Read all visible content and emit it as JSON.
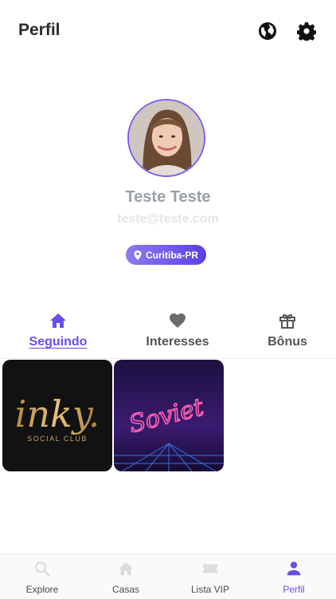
{
  "header": {
    "title": "Perfil",
    "globe_icon": "globe-icon",
    "settings_icon": "gear-icon"
  },
  "profile": {
    "name": "Teste Teste",
    "email": "teste@teste.com",
    "location": "Curitiba-PR"
  },
  "tabs": [
    {
      "label": "Seguindo",
      "icon": "home-icon",
      "active": true
    },
    {
      "label": "Interesses",
      "icon": "heart-icon",
      "active": false
    },
    {
      "label": "Bônus",
      "icon": "gift-icon",
      "active": false
    }
  ],
  "following": [
    {
      "logo_text": "inky.",
      "subtitle": "SOCIAL CLUB"
    },
    {
      "logo_text": "Soviet"
    }
  ],
  "bottom_nav": [
    {
      "label": "Explore",
      "icon": "search-icon",
      "active": false
    },
    {
      "label": "Casas",
      "icon": "home-icon",
      "active": false
    },
    {
      "label": "Lista VIP",
      "icon": "ticket-icon",
      "active": false
    },
    {
      "label": "Perfil",
      "icon": "person-icon",
      "active": true
    }
  ],
  "colors": {
    "accent": "#6a4ee8",
    "inactive_icon": "#d9d9d9"
  }
}
